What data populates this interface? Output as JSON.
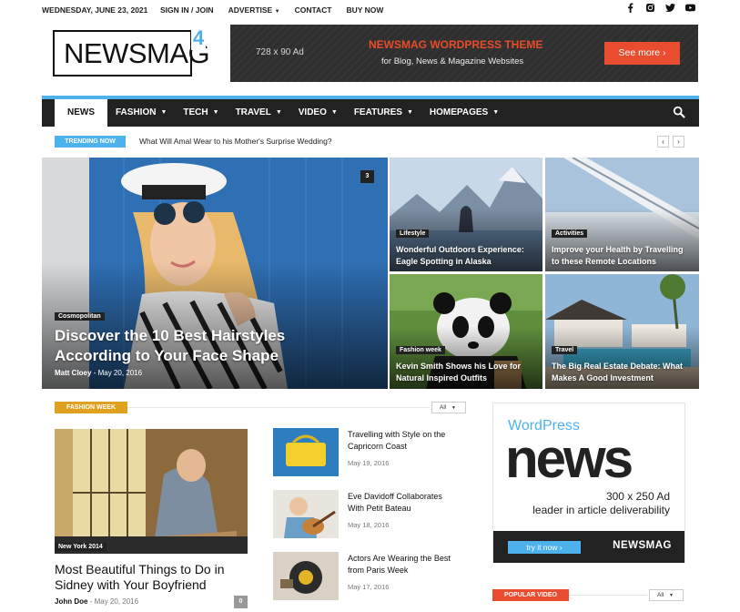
{
  "topbar": {
    "date": "WEDNESDAY, JUNE 23, 2021",
    "links": [
      "SIGN IN / JOIN",
      "ADVERTISE",
      "CONTACT",
      "BUY NOW"
    ]
  },
  "logo": {
    "text": "NEWSMAG",
    "version": "4"
  },
  "header_ad": {
    "size": "728 x 90 Ad",
    "headline": "NEWSMAG WORDPRESS THEME",
    "subline": "for Blog, News & Magazine Websites",
    "button": "See more  ›"
  },
  "nav": {
    "items": [
      {
        "label": "NEWS"
      },
      {
        "label": "FASHION"
      },
      {
        "label": "TECH"
      },
      {
        "label": "TRAVEL"
      },
      {
        "label": "VIDEO"
      },
      {
        "label": "FEATURES"
      },
      {
        "label": "HOMEPAGES"
      }
    ]
  },
  "trending": {
    "badge": "TRENDING NOW",
    "title": "What Will Amal Wear to his Mother's Surprise Wedding?",
    "prev": "‹",
    "next": "›"
  },
  "featured": {
    "main": {
      "category": "Cosmopolitan",
      "title_line1": "Discover the 10 Best Hairstyles",
      "title_line2": "According to Your Face Shape",
      "author": "Matt Cloey",
      "date": "May 20, 2016",
      "comments": "3"
    },
    "tiles": [
      {
        "category": "Lifestyle",
        "line1": "Wonderful Outdoors Experience:",
        "line2": "Eagle Spotting in Alaska"
      },
      {
        "category": "Activities",
        "line1": "Improve your Health by Travelling",
        "line2": "to these Remote Locations"
      },
      {
        "category": "Fashion week",
        "line1": "Kevin Smith Shows his Love for",
        "line2": "Natural Inspired Outfits"
      },
      {
        "category": "Travel",
        "line1": "The Big Real Estate Debate: What",
        "line2": "Makes A Good Investment"
      }
    ]
  },
  "fashion_week": {
    "badge": "FASHION WEEK",
    "filter": "All",
    "big": {
      "category": "New York 2014",
      "title_line1": "Most Beautiful Things to Do in",
      "title_line2": "Sidney with Your Boyfriend",
      "author": "John Doe",
      "date": "May 20, 2016",
      "comments": "0"
    },
    "items": [
      {
        "line1": "Travelling with Style on the",
        "line2": "Capricorn Coast",
        "date": "May 19, 2016"
      },
      {
        "line1": "Eve Davidoff Collaborates",
        "line2": "With Petit Bateau",
        "date": "May 18, 2016"
      },
      {
        "line1": "Actors Are Wearing the Best",
        "line2": "from Paris Week",
        "date": "May 17, 2016"
      }
    ]
  },
  "side_ad": {
    "wordpress": "WordPress",
    "news": "news",
    "size": "300 x 250 Ad",
    "tagline": "leader in article deliverability",
    "button": "try it now ›",
    "brand": "NEWSMAG"
  },
  "popular_video": {
    "badge": "POPULAR VIDEO",
    "filter": "All"
  },
  "colors": {
    "accent": "#4db2ec",
    "orange": "#e0a020",
    "red": "#e94c2e",
    "dark": "#222222"
  }
}
